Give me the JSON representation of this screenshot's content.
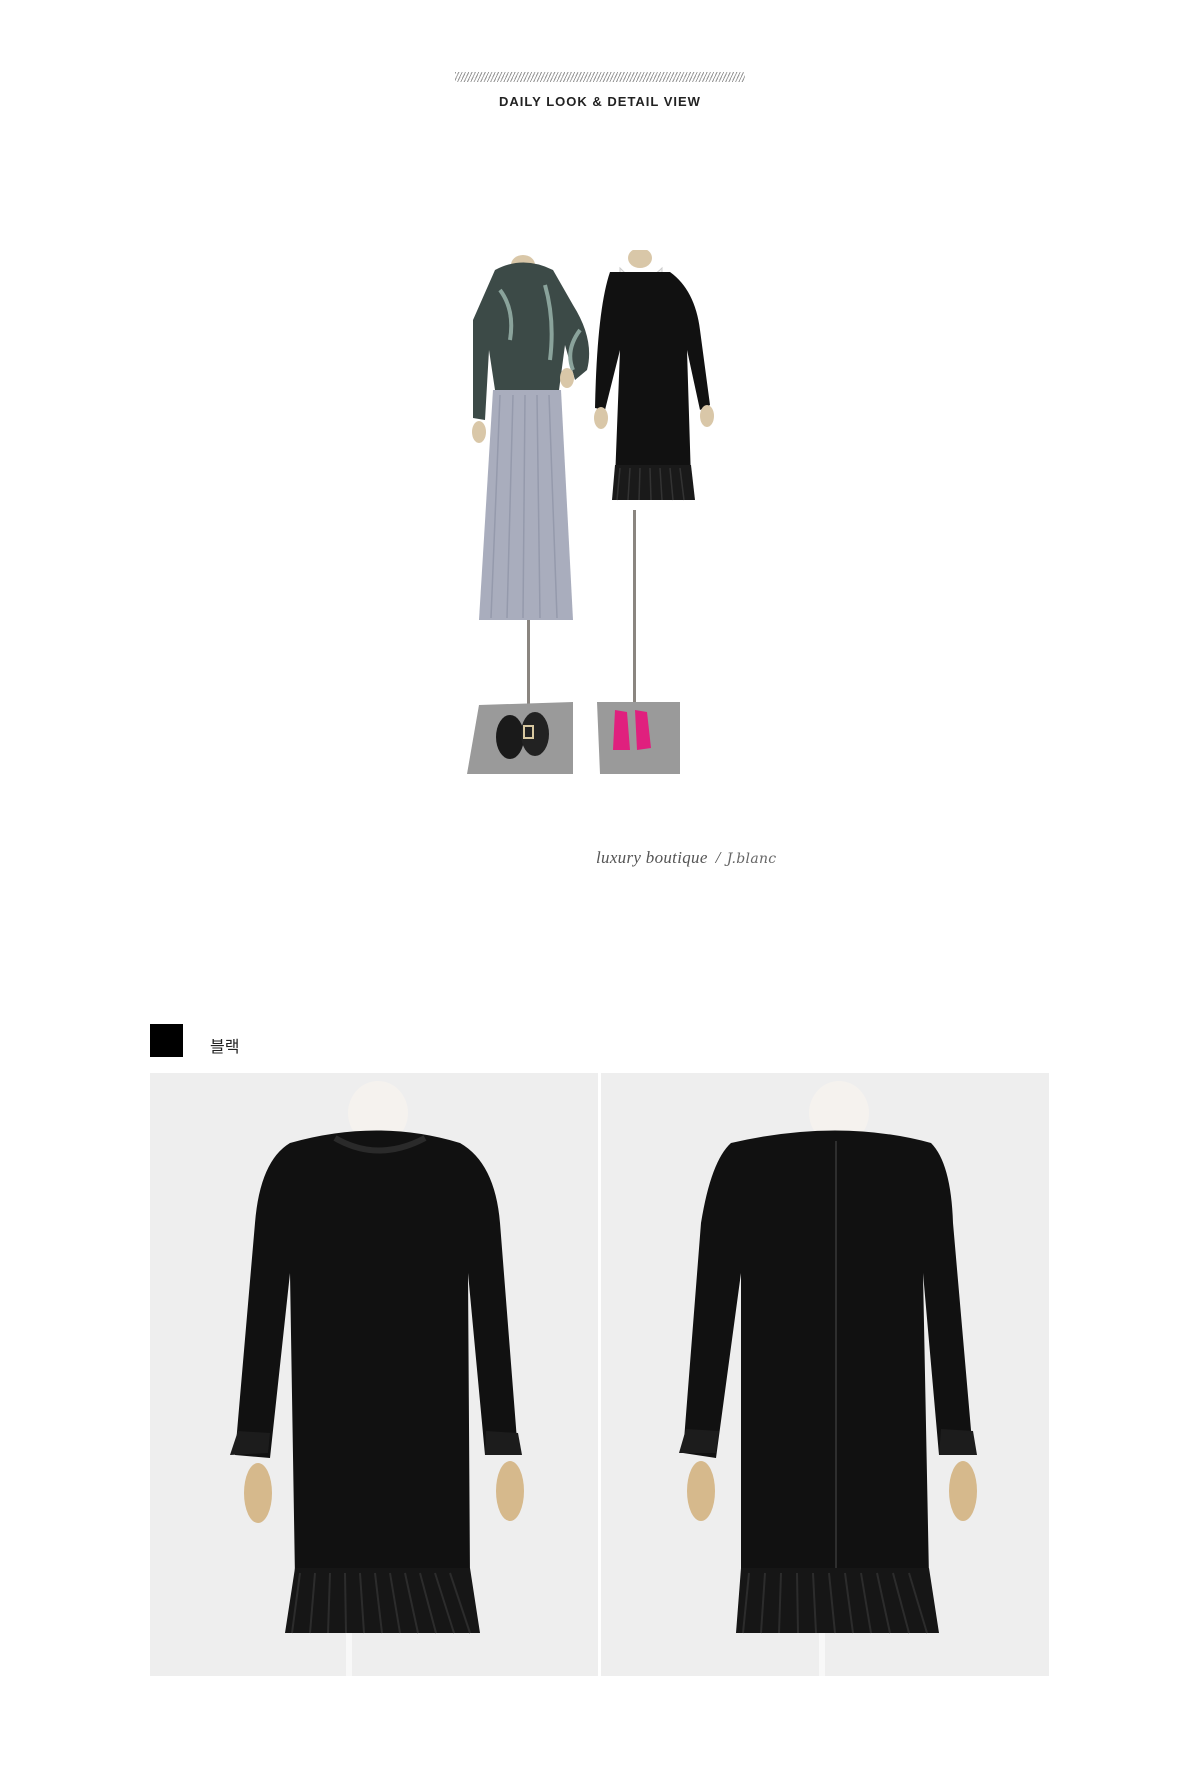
{
  "header": {
    "title": "DAILY LOOK & DETAIL VIEW"
  },
  "signature": {
    "text": "luxury boutique",
    "separator": "/",
    "brand_script": "J.blanc"
  },
  "color_option": {
    "swatch_color": "#000000",
    "label": "블랙"
  },
  "colors": {
    "background": "#ffffff",
    "photo_background": "#eeeeee",
    "dress": "#111111",
    "skirt": "#a9adbd",
    "shoes_pink": "#e0207e"
  }
}
